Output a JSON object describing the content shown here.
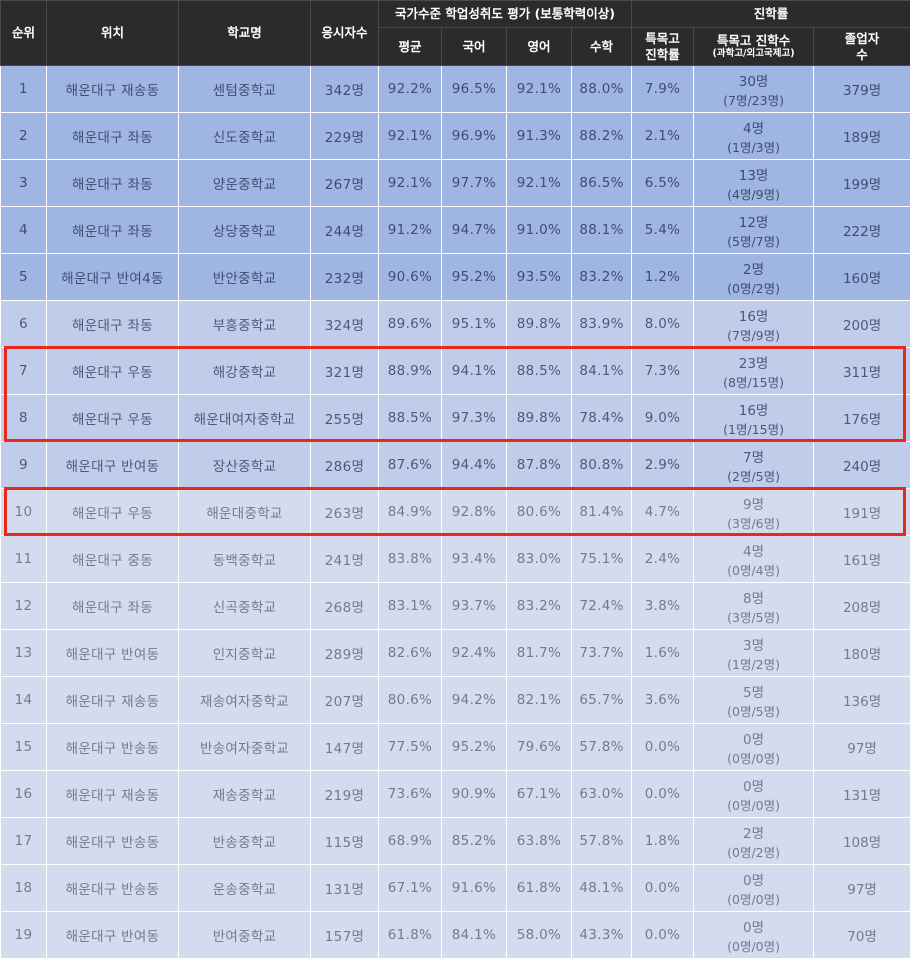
{
  "header": {
    "rank": "순위",
    "location": "위치",
    "school": "학교명",
    "examinees": "응시자수",
    "achievement_group": "국가수준 학업성취도 평가 (보통학력이상)",
    "average": "평균",
    "korean": "국어",
    "english": "영어",
    "math": "수학",
    "advancement_group": "진학률",
    "special_rate_line1": "특목고",
    "special_rate_line2": "진학률",
    "special_count": "특목고 진학수",
    "special_count_sub": "(과학고/외고국제고)",
    "graduates_line1": "졸업자",
    "graduates_line2": "수"
  },
  "colors": {
    "header_bg": "#2b2b2b",
    "group_a_bg": "#9fb6e2",
    "group_a_text": "#414b73",
    "group_b_bg": "#bfcdea",
    "group_b_text": "#4e5878",
    "group_c_bg": "#d3dcef",
    "group_c_text": "#737a8e",
    "highlight_border": "#e8281e"
  },
  "rows": [
    {
      "rank": "1",
      "location": "해운대구 재송동",
      "school": "센텀중학교",
      "examinees": "342명",
      "average": "92.2%",
      "korean": "96.5%",
      "english": "92.1%",
      "math": "88.0%",
      "special_rate": "7.9%",
      "special_count": "30명",
      "special_detail": "(7명/23명)",
      "graduates": "379명",
      "group": "a"
    },
    {
      "rank": "2",
      "location": "해운대구 좌동",
      "school": "신도중학교",
      "examinees": "229명",
      "average": "92.1%",
      "korean": "96.9%",
      "english": "91.3%",
      "math": "88.2%",
      "special_rate": "2.1%",
      "special_count": "4명",
      "special_detail": "(1명/3명)",
      "graduates": "189명",
      "group": "a"
    },
    {
      "rank": "3",
      "location": "해운대구 좌동",
      "school": "양운중학교",
      "examinees": "267명",
      "average": "92.1%",
      "korean": "97.7%",
      "english": "92.1%",
      "math": "86.5%",
      "special_rate": "6.5%",
      "special_count": "13명",
      "special_detail": "(4명/9명)",
      "graduates": "199명",
      "group": "a"
    },
    {
      "rank": "4",
      "location": "해운대구 좌동",
      "school": "상당중학교",
      "examinees": "244명",
      "average": "91.2%",
      "korean": "94.7%",
      "english": "91.0%",
      "math": "88.1%",
      "special_rate": "5.4%",
      "special_count": "12명",
      "special_detail": "(5명/7명)",
      "graduates": "222명",
      "group": "a"
    },
    {
      "rank": "5",
      "location": "해운대구 반여4동",
      "school": "반안중학교",
      "examinees": "232명",
      "average": "90.6%",
      "korean": "95.2%",
      "english": "93.5%",
      "math": "83.2%",
      "special_rate": "1.2%",
      "special_count": "2명",
      "special_detail": "(0명/2명)",
      "graduates": "160명",
      "group": "a"
    },
    {
      "rank": "6",
      "location": "해운대구 좌동",
      "school": "부흥중학교",
      "examinees": "324명",
      "average": "89.6%",
      "korean": "95.1%",
      "english": "89.8%",
      "math": "83.9%",
      "special_rate": "8.0%",
      "special_count": "16명",
      "special_detail": "(7명/9명)",
      "graduates": "200명",
      "group": "b"
    },
    {
      "rank": "7",
      "location": "해운대구 우동",
      "school": "해강중학교",
      "examinees": "321명",
      "average": "88.9%",
      "korean": "94.1%",
      "english": "88.5%",
      "math": "84.1%",
      "special_rate": "7.3%",
      "special_count": "23명",
      "special_detail": "(8명/15명)",
      "graduates": "311명",
      "group": "b"
    },
    {
      "rank": "8",
      "location": "해운대구 우동",
      "school": "해운대여자중학교",
      "examinees": "255명",
      "average": "88.5%",
      "korean": "97.3%",
      "english": "89.8%",
      "math": "78.4%",
      "special_rate": "9.0%",
      "special_count": "16명",
      "special_detail": "(1명/15명)",
      "graduates": "176명",
      "group": "b"
    },
    {
      "rank": "9",
      "location": "해운대구 반여동",
      "school": "장산중학교",
      "examinees": "286명",
      "average": "87.6%",
      "korean": "94.4%",
      "english": "87.8%",
      "math": "80.8%",
      "special_rate": "2.9%",
      "special_count": "7명",
      "special_detail": "(2명/5명)",
      "graduates": "240명",
      "group": "b"
    },
    {
      "rank": "10",
      "location": "해운대구 우동",
      "school": "해운대중학교",
      "examinees": "263명",
      "average": "84.9%",
      "korean": "92.8%",
      "english": "80.6%",
      "math": "81.4%",
      "special_rate": "4.7%",
      "special_count": "9명",
      "special_detail": "(3명/6명)",
      "graduates": "191명",
      "group": "c"
    },
    {
      "rank": "11",
      "location": "해운대구 중동",
      "school": "동백중학교",
      "examinees": "241명",
      "average": "83.8%",
      "korean": "93.4%",
      "english": "83.0%",
      "math": "75.1%",
      "special_rate": "2.4%",
      "special_count": "4명",
      "special_detail": "(0명/4명)",
      "graduates": "161명",
      "group": "c"
    },
    {
      "rank": "12",
      "location": "해운대구 좌동",
      "school": "신곡중학교",
      "examinees": "268명",
      "average": "83.1%",
      "korean": "93.7%",
      "english": "83.2%",
      "math": "72.4%",
      "special_rate": "3.8%",
      "special_count": "8명",
      "special_detail": "(3명/5명)",
      "graduates": "208명",
      "group": "c"
    },
    {
      "rank": "13",
      "location": "해운대구 반여동",
      "school": "인지중학교",
      "examinees": "289명",
      "average": "82.6%",
      "korean": "92.4%",
      "english": "81.7%",
      "math": "73.7%",
      "special_rate": "1.6%",
      "special_count": "3명",
      "special_detail": "(1명/2명)",
      "graduates": "180명",
      "group": "c"
    },
    {
      "rank": "14",
      "location": "해운대구 재송동",
      "school": "재송여자중학교",
      "examinees": "207명",
      "average": "80.6%",
      "korean": "94.2%",
      "english": "82.1%",
      "math": "65.7%",
      "special_rate": "3.6%",
      "special_count": "5명",
      "special_detail": "(0명/5명)",
      "graduates": "136명",
      "group": "c"
    },
    {
      "rank": "15",
      "location": "해운대구 반송동",
      "school": "반송여자중학교",
      "examinees": "147명",
      "average": "77.5%",
      "korean": "95.2%",
      "english": "79.6%",
      "math": "57.8%",
      "special_rate": "0.0%",
      "special_count": "0명",
      "special_detail": "(0명/0명)",
      "graduates": "97명",
      "group": "c"
    },
    {
      "rank": "16",
      "location": "해운대구 재송동",
      "school": "재송중학교",
      "examinees": "219명",
      "average": "73.6%",
      "korean": "90.9%",
      "english": "67.1%",
      "math": "63.0%",
      "special_rate": "0.0%",
      "special_count": "0명",
      "special_detail": "(0명/0명)",
      "graduates": "131명",
      "group": "c"
    },
    {
      "rank": "17",
      "location": "해운대구 반송동",
      "school": "반송중학교",
      "examinees": "115명",
      "average": "68.9%",
      "korean": "85.2%",
      "english": "63.8%",
      "math": "57.8%",
      "special_rate": "1.8%",
      "special_count": "2명",
      "special_detail": "(0명/2명)",
      "graduates": "108명",
      "group": "c"
    },
    {
      "rank": "18",
      "location": "해운대구 반송동",
      "school": "운송중학교",
      "examinees": "131명",
      "average": "67.1%",
      "korean": "91.6%",
      "english": "61.8%",
      "math": "48.1%",
      "special_rate": "0.0%",
      "special_count": "0명",
      "special_detail": "(0명/0명)",
      "graduates": "97명",
      "group": "c"
    },
    {
      "rank": "19",
      "location": "해운대구 반여동",
      "school": "반여중학교",
      "examinees": "157명",
      "average": "61.8%",
      "korean": "84.1%",
      "english": "58.0%",
      "math": "43.3%",
      "special_rate": "0.0%",
      "special_count": "0명",
      "special_detail": "(0명/0명)",
      "graduates": "70명",
      "group": "c"
    }
  ],
  "highlighted_rows": [
    "7",
    "8",
    "10"
  ]
}
